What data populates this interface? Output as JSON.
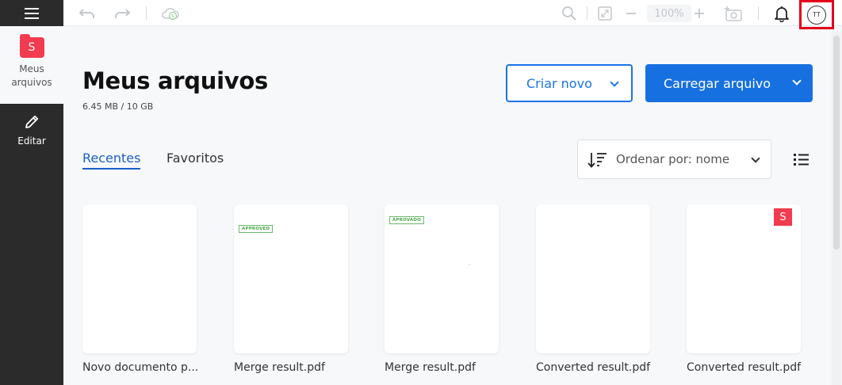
{
  "sidebar": {
    "menu_icon": "hamburger-icon",
    "items": [
      {
        "label": "Meus\narquivos",
        "icon": "folder-s-icon",
        "icon_text": "S"
      },
      {
        "label": "Editar",
        "icon": "pencil-icon"
      }
    ]
  },
  "toolbar": {
    "zoom": "100%",
    "user_initials": "TT",
    "icons": [
      "undo-icon",
      "redo-icon",
      "cloud-sync-icon",
      "search-icon",
      "fit-screen-icon",
      "zoom-out-icon",
      "zoom-in-icon",
      "screenshot-icon",
      "bell-icon",
      "avatar"
    ]
  },
  "header": {
    "title": "Meus arquivos",
    "storage": "6.45 MB / 10 GB",
    "create_label": "Criar novo",
    "upload_label": "Carregar arquivo"
  },
  "tabs": [
    {
      "label": "Recentes",
      "active": true
    },
    {
      "label": "Favoritos",
      "active": false
    }
  ],
  "sort": {
    "label": "Ordenar por: nome"
  },
  "files": [
    {
      "name": "Novo documento p...",
      "stamp": ""
    },
    {
      "name": "Merge result.pdf",
      "stamp": "APPROVED"
    },
    {
      "name": "Merge result.pdf",
      "stamp": "APROVADO"
    },
    {
      "name": "Converted result.pdf",
      "stamp": ""
    },
    {
      "name": "Converted result.pdf",
      "stamp": "",
      "logo": "S"
    }
  ],
  "colors": {
    "accent": "#1770e0",
    "brand": "#f23b4f",
    "sidebar": "#2b2b2b",
    "highlight": "#e3001b"
  }
}
